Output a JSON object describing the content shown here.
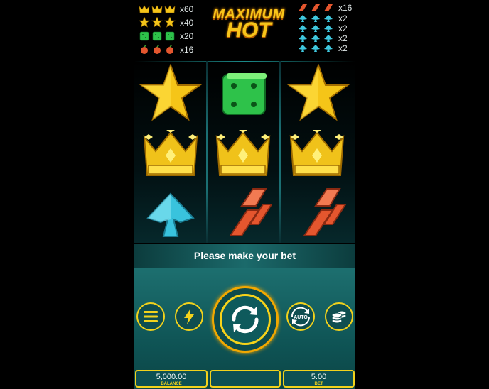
{
  "paytable": {
    "left": [
      {
        "symbol": "crown-icon",
        "multiplier": "x60"
      },
      {
        "symbol": "star-icon",
        "multiplier": "x40"
      },
      {
        "symbol": "dice-icon",
        "multiplier": "x20"
      },
      {
        "symbol": "cherry-icon",
        "multiplier": "x16"
      }
    ],
    "right": [
      {
        "symbol": "cherry-icon",
        "multiplier": "x16"
      },
      {
        "symbol": "spade-icon",
        "multiplier": "x2"
      },
      {
        "symbol": "spade-icon",
        "multiplier": "x2"
      },
      {
        "symbol": "spade-icon",
        "multiplier": "x2"
      },
      {
        "symbol": "spade-icon",
        "multiplier": "x2"
      }
    ]
  },
  "logo": {
    "line1": "MAXIMUM",
    "line2": "HOT"
  },
  "reels": [
    [
      "star-icon",
      "crown-icon",
      "spade-icon"
    ],
    [
      "dice-icon",
      "crown-icon",
      "cherry-icon"
    ],
    [
      "star-icon",
      "crown-icon",
      "cherry-icon"
    ]
  ],
  "message": "Please make your bet",
  "buttons": {
    "menu": "menu-icon",
    "turbo": "lightning-icon",
    "spin": "spin-icon",
    "auto": "AUTO",
    "stake": "coins-icon"
  },
  "balance": {
    "value": "5,000.00",
    "label": "BALANCE"
  },
  "win": {
    "value": ""
  },
  "bet": {
    "value": "5.00",
    "label": "BET"
  },
  "colors": {
    "gold": "#f2d21c",
    "panel": "#0f5556",
    "star": "#f7c51a",
    "dice": "#2ec24a",
    "spade": "#3fc8df",
    "cherry": "#e4562e"
  }
}
